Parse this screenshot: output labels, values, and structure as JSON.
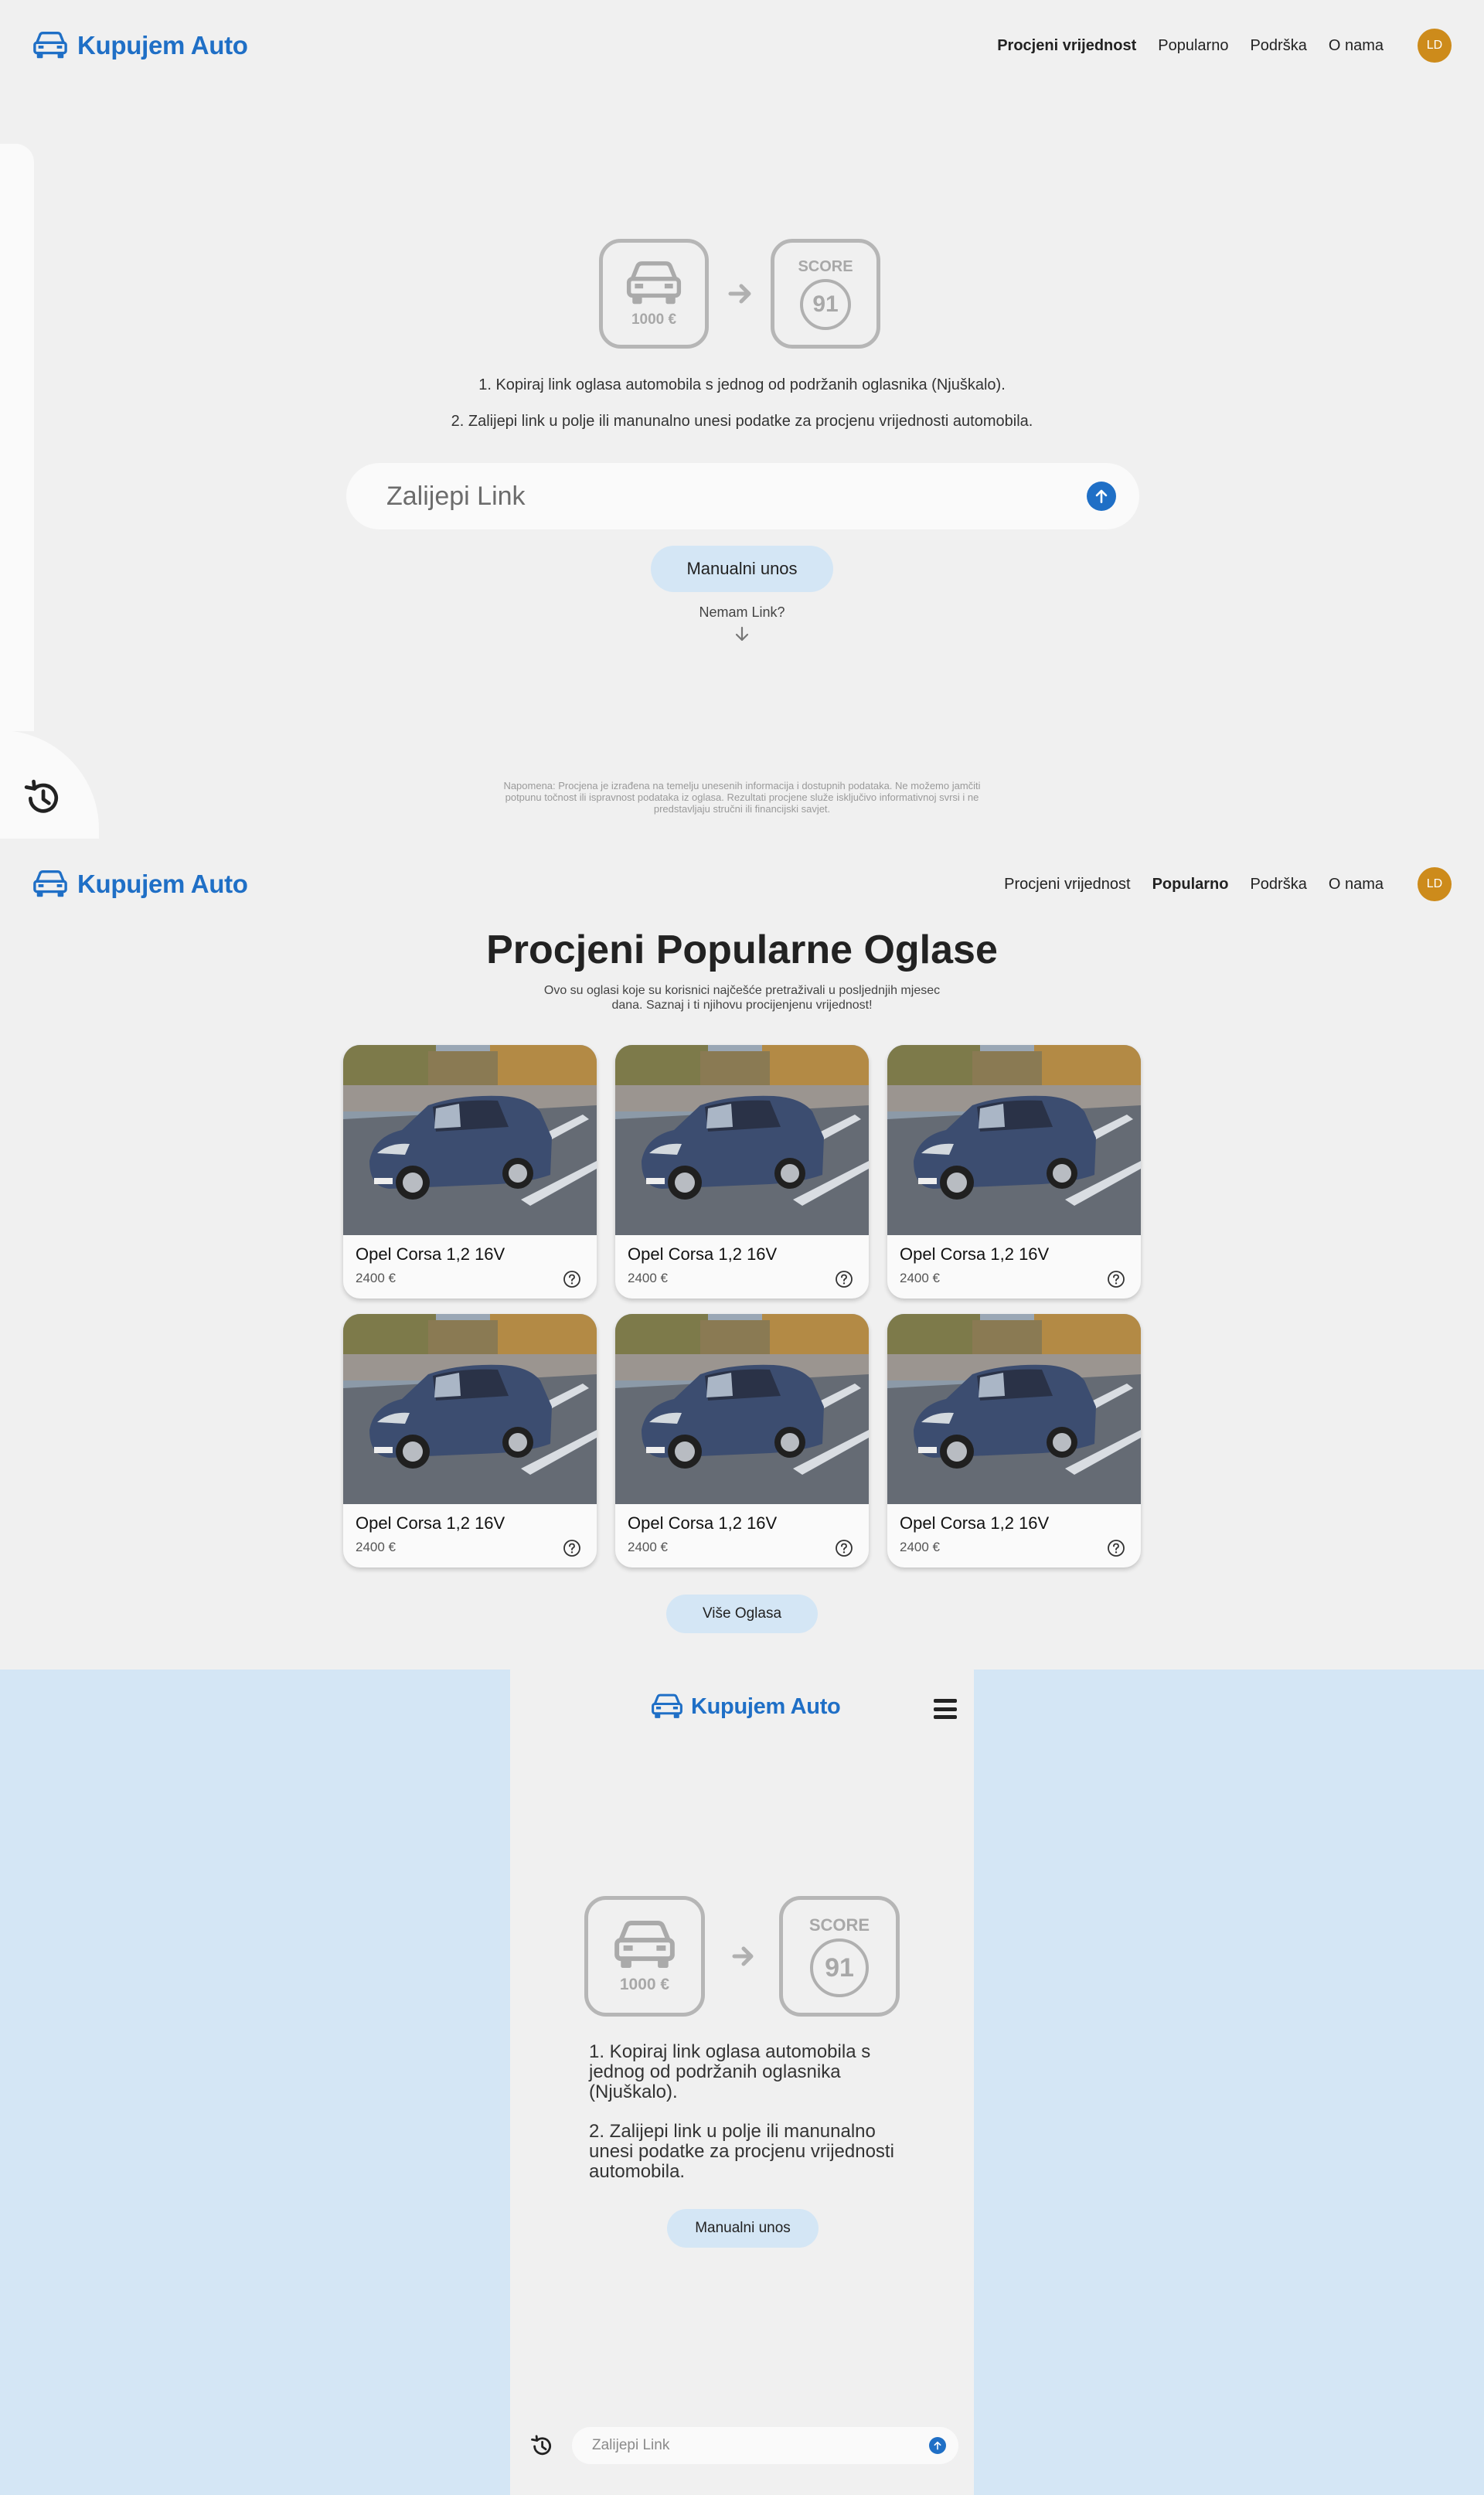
{
  "brand": {
    "name": "Kupujem Auto",
    "color": "#1f6fc6"
  },
  "nav": {
    "items": [
      "Procjeni vrijednost",
      "Popularno",
      "Podrška",
      "O nama"
    ],
    "avatar_initials": "LD"
  },
  "hero": {
    "price_label": "1000 €",
    "score_label": "SCORE",
    "score_value": "91",
    "step1": "1. Kopiraj link oglasa automobila s jednog od podržanih oglasnika (Njuškalo).",
    "step2": "2. Zalijepi link u polje ili manunalno unesi podatke za procjenu vrijednosti automobila.",
    "link_placeholder": "Zalijepi Link",
    "manual_button": "Manualni unos",
    "no_link": "Nemam Link?",
    "disclaimer": "Napomena: Procjena je izrađena na temelju unesenih informacija i dostupnih podataka. Ne možemo jamčiti potpunu točnost ili ispravnost podataka iz oglasa. Rezultati procjene služe isključivo informativnoj svrsi i ne predstavljaju stručni ili financijski savjet."
  },
  "popular": {
    "title": "Procjeni Popularne Oglase",
    "subtitle": "Ovo su oglasi koje su korisnici najčešće pretraživali u posljednjih mjesec dana. Saznaj i ti njihovu procijenjenu vrijednost!",
    "cards": [
      {
        "title": "Opel Corsa 1,2 16V",
        "price": "2400 €"
      },
      {
        "title": "Opel Corsa 1,2 16V",
        "price": "2400 €"
      },
      {
        "title": "Opel Corsa 1,2 16V",
        "price": "2400 €"
      },
      {
        "title": "Opel Corsa 1,2 16V",
        "price": "2400 €"
      },
      {
        "title": "Opel Corsa 1,2 16V",
        "price": "2400 €"
      },
      {
        "title": "Opel Corsa 1,2 16V",
        "price": "2400 €"
      }
    ],
    "more_button": "Više Oglasa"
  },
  "mobile": {
    "step1": "1. Kopiraj link oglasa automobila s jednog od podržanih oglasnika (Njuškalo).",
    "step2": "2. Zalijepi link u polje ili manunalno unesi podatke za procjenu vrijednosti automobila.",
    "manual_button": "Manualni unos",
    "link_placeholder": "Zalijepi Link"
  },
  "icons": [
    "car-icon",
    "arrow-right-icon",
    "arrow-up-icon",
    "arrow-down-icon",
    "history-icon",
    "info-icon",
    "hamburger-menu-icon"
  ],
  "colors": {
    "accent": "#1f6fc6",
    "pill": "#d4e6f5",
    "avatar": "#cd8b1b",
    "background": "#f0f0f0"
  }
}
